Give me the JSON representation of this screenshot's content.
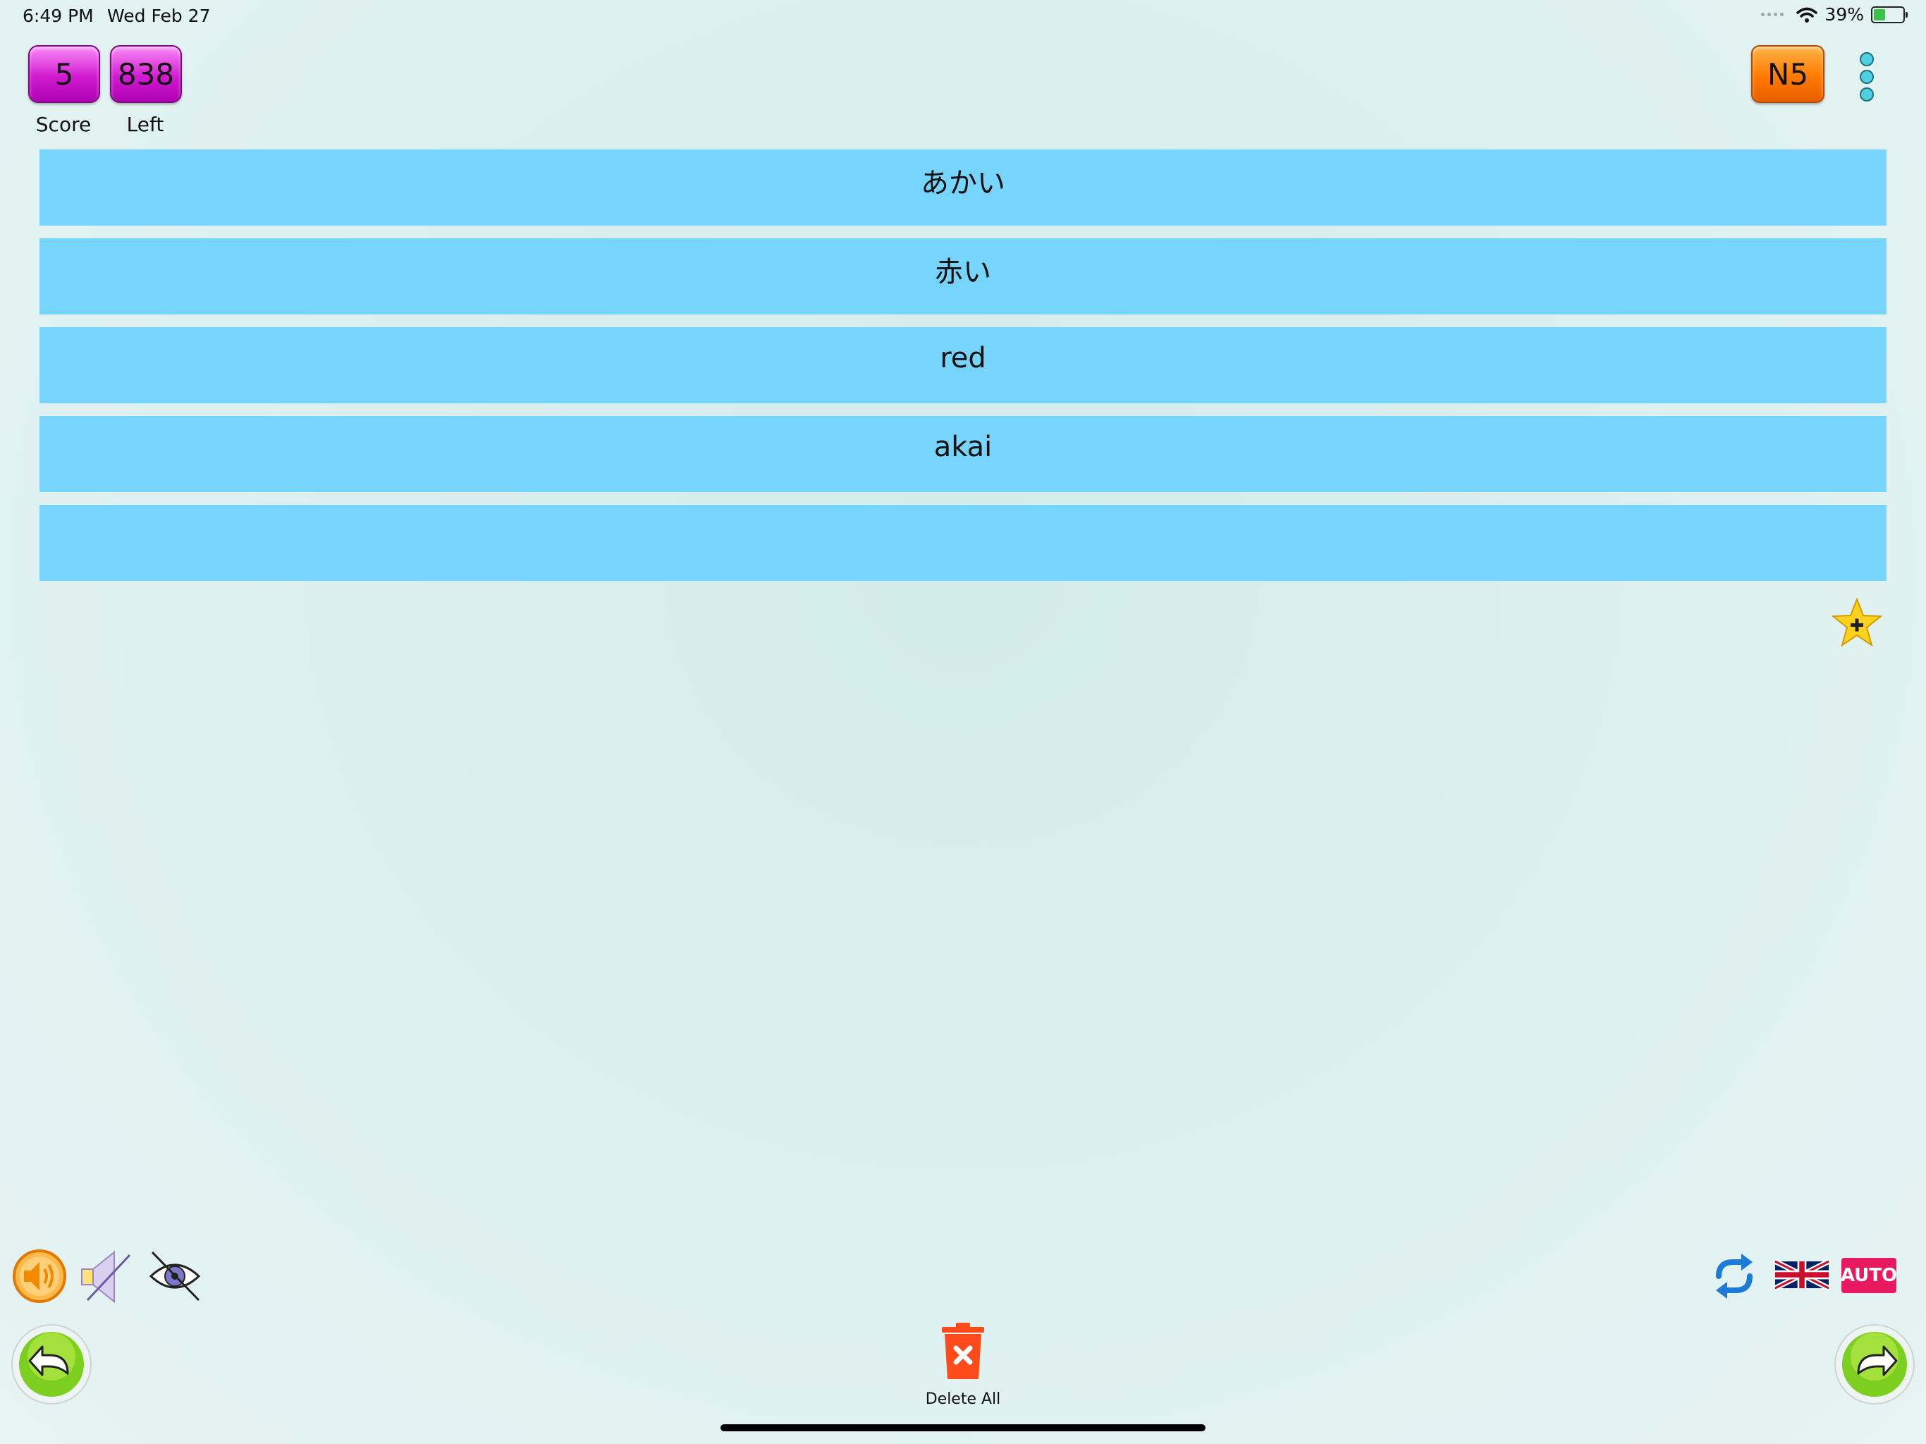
{
  "status_bar": {
    "time": "6:49 PM",
    "date": "Wed Feb 27",
    "battery_percent": "39%",
    "battery_level": 0.39
  },
  "header": {
    "score": {
      "value": "5",
      "label": "Score"
    },
    "left": {
      "value": "838",
      "label": "Left"
    },
    "level_button": "N5"
  },
  "cards": [
    {
      "text": "あかい"
    },
    {
      "text": "赤い"
    },
    {
      "text": "red"
    },
    {
      "text": "akai"
    },
    {
      "text": ""
    }
  ],
  "toolbar": {
    "delete_all_label": "Delete All",
    "auto_label": "AUTO"
  },
  "colors": {
    "card": "#77d4fd",
    "counter": "#d11bd1",
    "level": "#ff7a00",
    "nav_green": "#7ccf1f",
    "trash": "#ff4a1c",
    "auto": "#e8195e"
  },
  "icons": [
    "speaker-icon",
    "mute-icon",
    "hide-eye-icon",
    "repeat-icon",
    "uk-flag-icon",
    "back-arrow-icon",
    "forward-arrow-icon",
    "trash-icon",
    "add-favorite-star-icon",
    "menu-dots-icon"
  ]
}
